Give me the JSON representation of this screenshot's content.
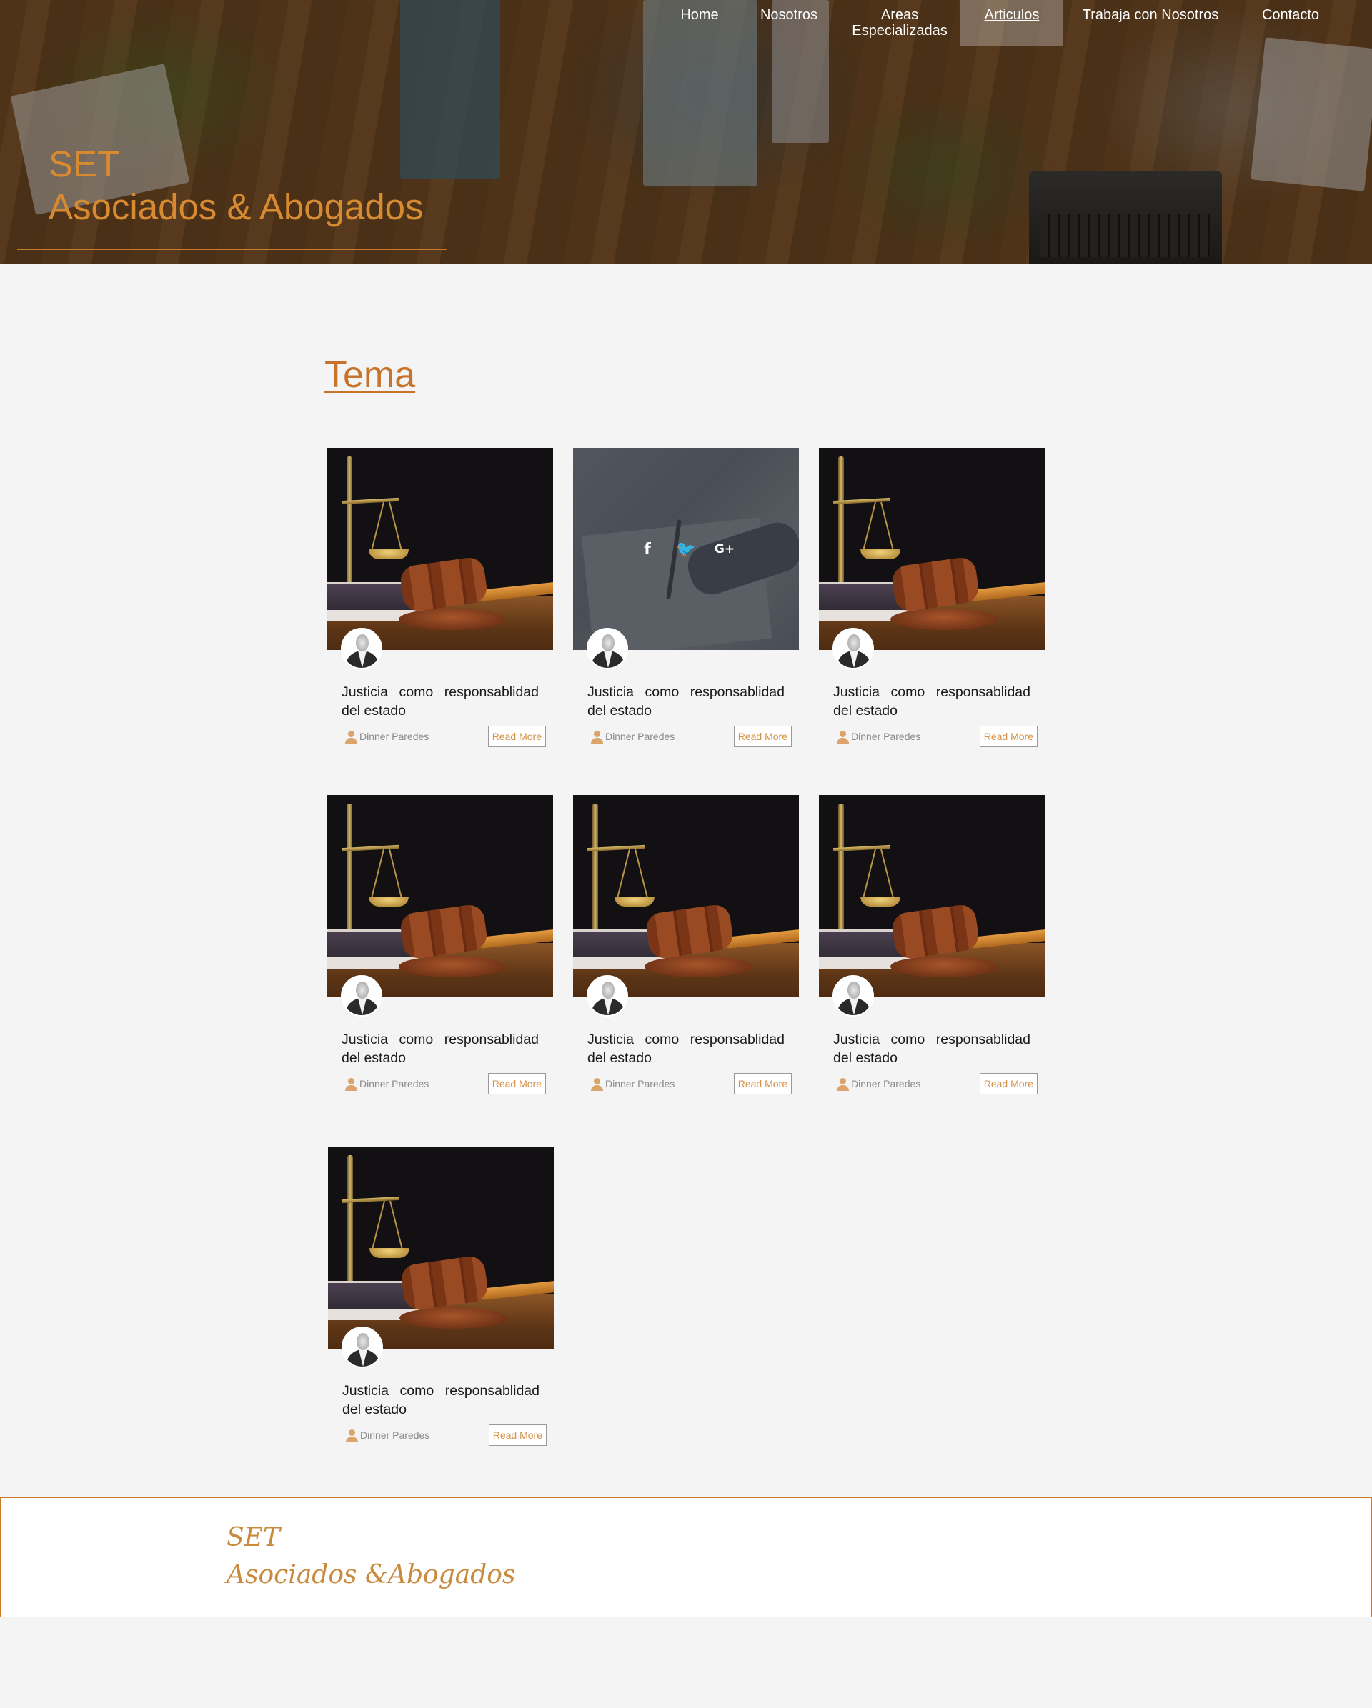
{
  "nav": {
    "items": [
      {
        "label": "Home"
      },
      {
        "label": "Nosotros"
      },
      {
        "label": "Areas\nEspecializadas"
      },
      {
        "label": "Articulos",
        "active": true
      },
      {
        "label": "Trabaja con Nosotros"
      },
      {
        "label": "Contacto"
      }
    ]
  },
  "hero": {
    "brand_line1": "SET",
    "brand_line2": "Asociados & Abogados"
  },
  "section": {
    "title": "Tema"
  },
  "cards": [
    {
      "title": "Justicia como responsablidad del estado",
      "author": "Dinner Paredes",
      "button": "Read More",
      "image": "scales-gavel"
    },
    {
      "title": "Justicia como responsablidad del estado",
      "author": "Dinner Paredes",
      "button": "Read More",
      "image": "signing-document",
      "hover": true
    },
    {
      "title": "Justicia como responsablidad del estado",
      "author": "Dinner Paredes",
      "button": "Read More",
      "image": "scales-gavel"
    },
    {
      "title": "Justicia como responsablidad del estado",
      "author": "Dinner Paredes",
      "button": "Read More",
      "image": "scales-gavel"
    },
    {
      "title": "Justicia como responsablidad del estado",
      "author": "Dinner Paredes",
      "button": "Read More",
      "image": "scales-gavel"
    },
    {
      "title": "Justicia como responsablidad del estado",
      "author": "Dinner Paredes",
      "button": "Read More",
      "image": "scales-gavel"
    },
    {
      "title": "Justicia como responsablidad del estado",
      "author": "Dinner Paredes",
      "button": "Read More",
      "image": "scales-gavel"
    }
  ],
  "social_icons": [
    "facebook-icon",
    "twitter-icon",
    "google-plus-icon"
  ],
  "social_glyphs": [
    "f",
    "🐦",
    "G+"
  ],
  "footer": {
    "logo_line1": "SET",
    "logo_line2": "Asociados &Abogados"
  },
  "colors": {
    "accent": "#c7732a",
    "brand_orange": "#d88a31",
    "background": "#f4f4f4"
  }
}
